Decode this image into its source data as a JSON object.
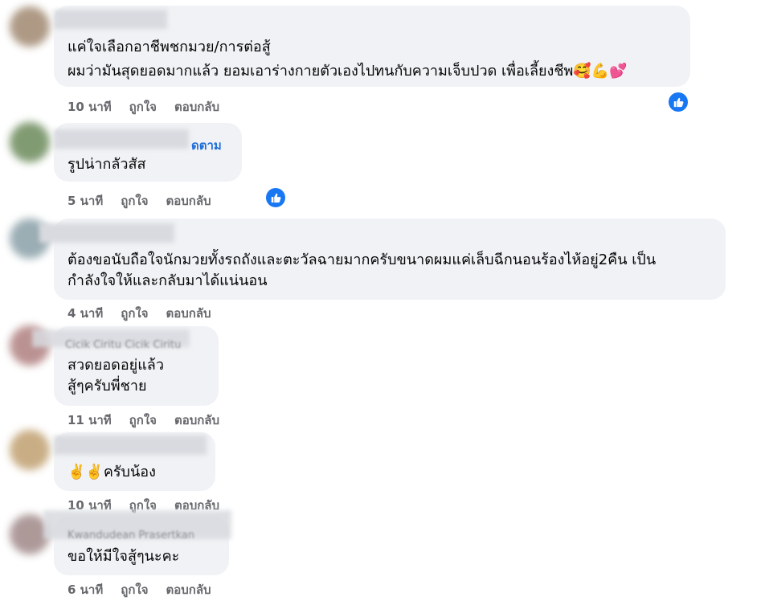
{
  "comments": [
    {
      "lines": [
        "แค่ใจเลือกอาชีพชกมวย/การต่อสู้",
        "ผมว่ามันสุดยอดมากแล้ว ยอมเอาร่างกายตัวเองไปทนกับความเจ็บปวด เพื่อเลี้ยงชีพ"
      ],
      "emoji": "🥰💪💕",
      "time": "10 นาที",
      "like": "ถูกใจ",
      "reply": "ตอบกลับ",
      "avatar_color": "#a08870"
    },
    {
      "name_suffix": "ดตาม",
      "lines": [
        "รูปน่ากลัวสัส"
      ],
      "time": "5 นาที",
      "like": "ถูกใจ",
      "reply": "ตอบกลับ",
      "avatar_color": "#6b8a5a"
    },
    {
      "lines": [
        "ต้องขอนับถือใจนักมวยทั้งรถถังและตะวัลฉายมากครับขนาดผมแค่เล็บฉีกนอนร้องไห้อยู่2คืน เป็น",
        "กำลังใจให้และกลับมาได้แน่นอน"
      ],
      "time": "4 นาที",
      "like": "ถูกใจ",
      "reply": "ตอบกลับ",
      "avatar_color": "#8aa0a8"
    },
    {
      "ghost_name": "Cicik Ciritu Cicik Ciritu",
      "lines": [
        "สวดยอดอยู่แล้ว",
        "สู้ๆครับพี่ชาย"
      ],
      "time": "11 นาที",
      "like": "ถูกใจ",
      "reply": "ตอบกลับ",
      "avatar_color": "#b08080"
    },
    {
      "emoji": "✌️✌️",
      "lines": [
        "ครับน้อง"
      ],
      "time": "10 นาที",
      "like": "ถูกใจ",
      "reply": "ตอบกลับ",
      "avatar_color": "#c0a070"
    },
    {
      "ghost_name": "Kwandudean Prasertkan",
      "lines": [
        "ขอให้มีใจสู้ๆนะคะ"
      ],
      "time": "6 นาที",
      "like": "ถูกใจ",
      "reply": "ตอบกลับ",
      "avatar_color": "#a08888"
    }
  ],
  "icons": {
    "like_badge": "thumbs-up-icon"
  },
  "colors": {
    "bubble": "#f0f2f5",
    "meta": "#65676b",
    "link": "#216fdb",
    "like": "#1877f2"
  }
}
